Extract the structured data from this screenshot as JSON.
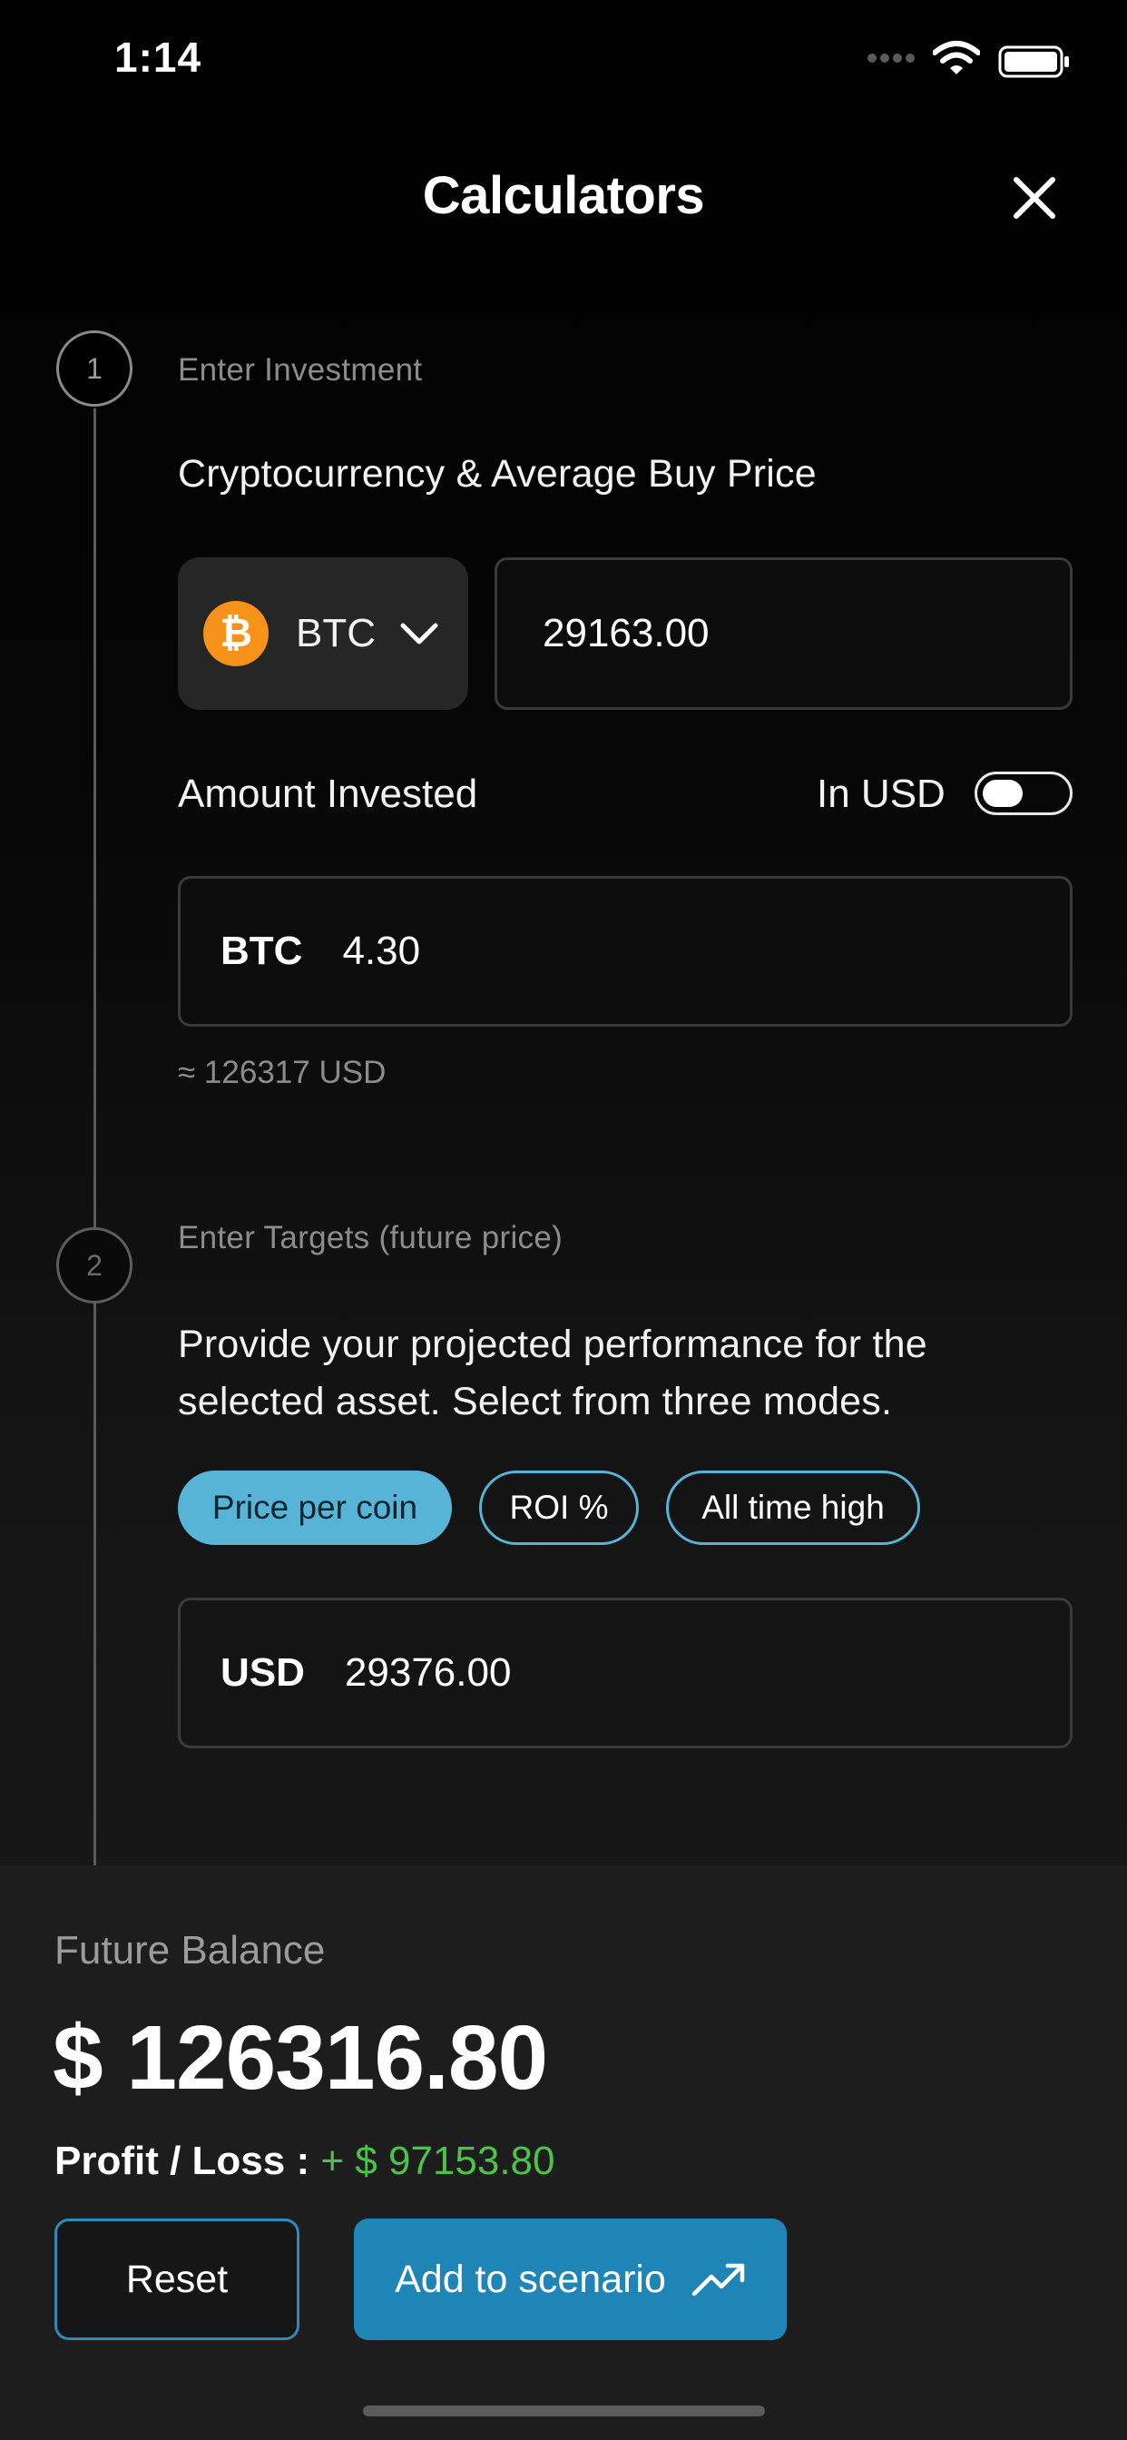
{
  "status_bar": {
    "time": "1:14"
  },
  "header": {
    "title": "Calculators"
  },
  "step1": {
    "number": "1",
    "label": "Enter Investment",
    "heading": "Cryptocurrency & Average Buy Price",
    "coin": {
      "symbol": "BTC",
      "icon_glyph": "₿",
      "icon": "bitcoin-icon",
      "color": "#f7931a"
    },
    "avg_buy_price": "29163.00",
    "amount_label": "Amount Invested",
    "usd_toggle_label": "In USD",
    "usd_toggle_on": false,
    "amount_unit": "BTC",
    "amount_value": "4.30",
    "approx_usd": "≈ 126317 USD"
  },
  "step2": {
    "number": "2",
    "label": "Enter Targets (future price)",
    "description": "Provide your projected performance for the selected asset. Select from three modes.",
    "modes": [
      "Price per coin",
      "ROI %",
      "All time high"
    ],
    "selected_mode": "Price per coin",
    "target_unit": "USD",
    "target_value": "29376.00"
  },
  "summary": {
    "future_balance_label": "Future Balance",
    "future_balance_value": "$ 126316.80",
    "profit_loss_label": "Profit / Loss : ",
    "profit_loss_value": "+ $ 97153.80",
    "reset_label": "Reset",
    "add_label": "Add to scenario"
  },
  "colors": {
    "accent": "#58b4d6",
    "primary_button": "#1e85b6",
    "profit": "#4cc24a"
  }
}
